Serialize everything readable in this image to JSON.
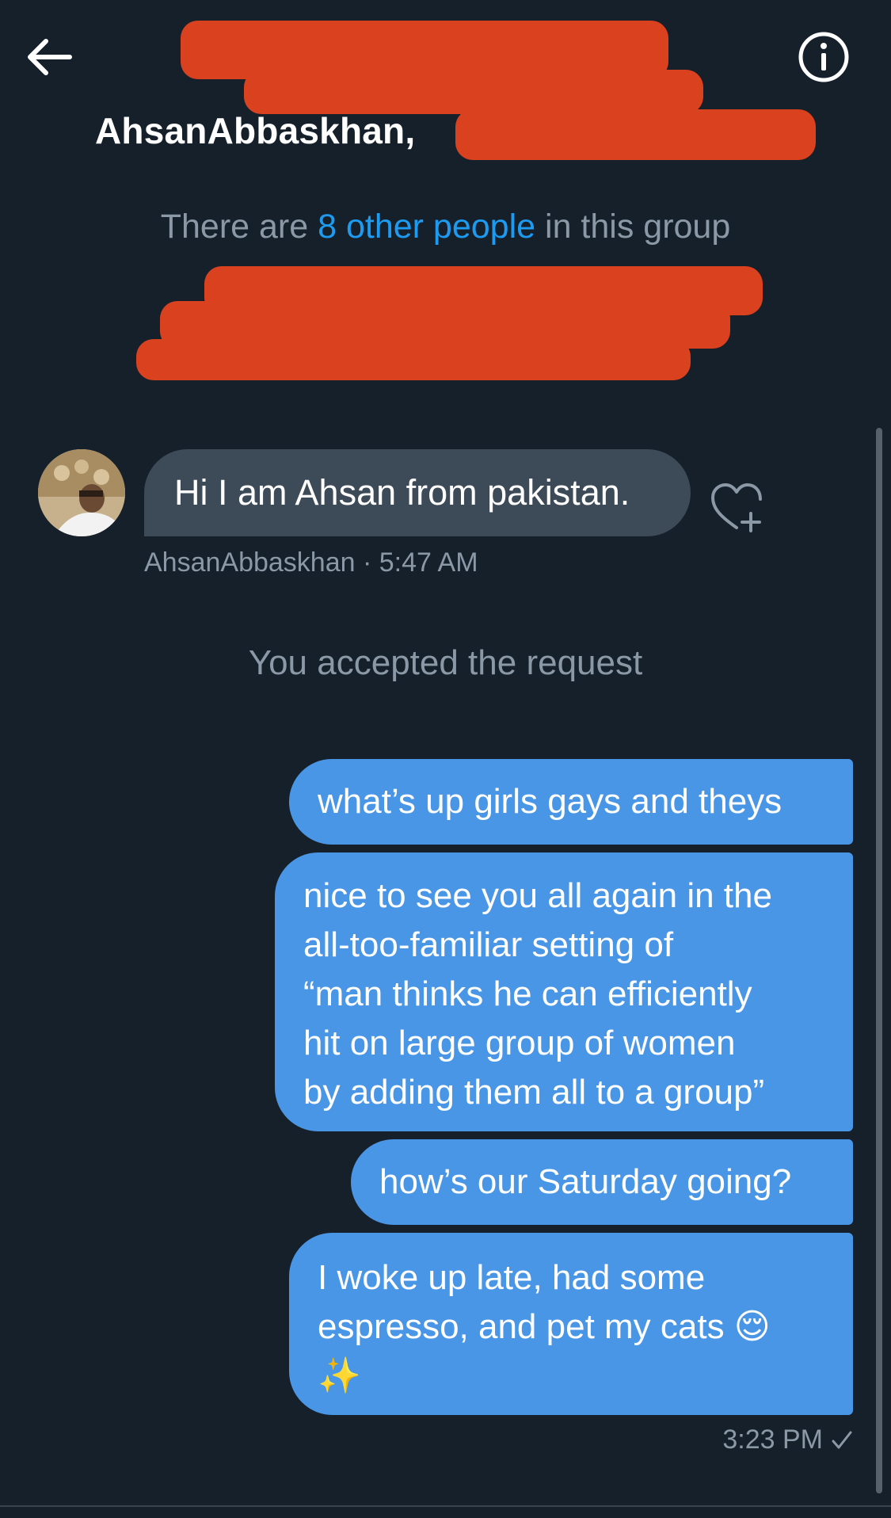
{
  "header": {
    "back_icon": "arrow-left-icon",
    "info_icon": "info-circle-icon",
    "group_name": "AhsanAbbaskhan,"
  },
  "group_info": {
    "prefix": "There are ",
    "link": "8 other people",
    "suffix": " in this group"
  },
  "colors": {
    "background": "#15202b",
    "incoming_bubble": "#3d4a57",
    "outgoing_bubble": "#4a96e6",
    "link": "#1d9bf0",
    "muted_text": "#8b98a5",
    "redaction": "#d9411f"
  },
  "incoming_message": {
    "text": "Hi I am Ahsan from pakistan.",
    "sender": "AhsanAbbaskhan",
    "separator": " · ",
    "time": "5:47 AM",
    "react_icon": "heart-plus-icon"
  },
  "system_message": "You accepted the request",
  "outgoing_messages": [
    {
      "lines": [
        "what’s up girls gays and theys"
      ]
    },
    {
      "lines": [
        "nice to see you all again in the",
        "all-too-familiar setting of",
        "“man thinks he can efficiently",
        "hit on large group of women",
        "by adding them all to a group”"
      ]
    },
    {
      "lines": [
        "how’s our Saturday going?"
      ]
    },
    {
      "lines": [
        "I woke up late, had some",
        "espresso, and pet my cats 😌",
        "✨"
      ]
    }
  ],
  "outgoing_meta": {
    "time": "3:23 PM",
    "status_icon": "checkmark-icon"
  }
}
